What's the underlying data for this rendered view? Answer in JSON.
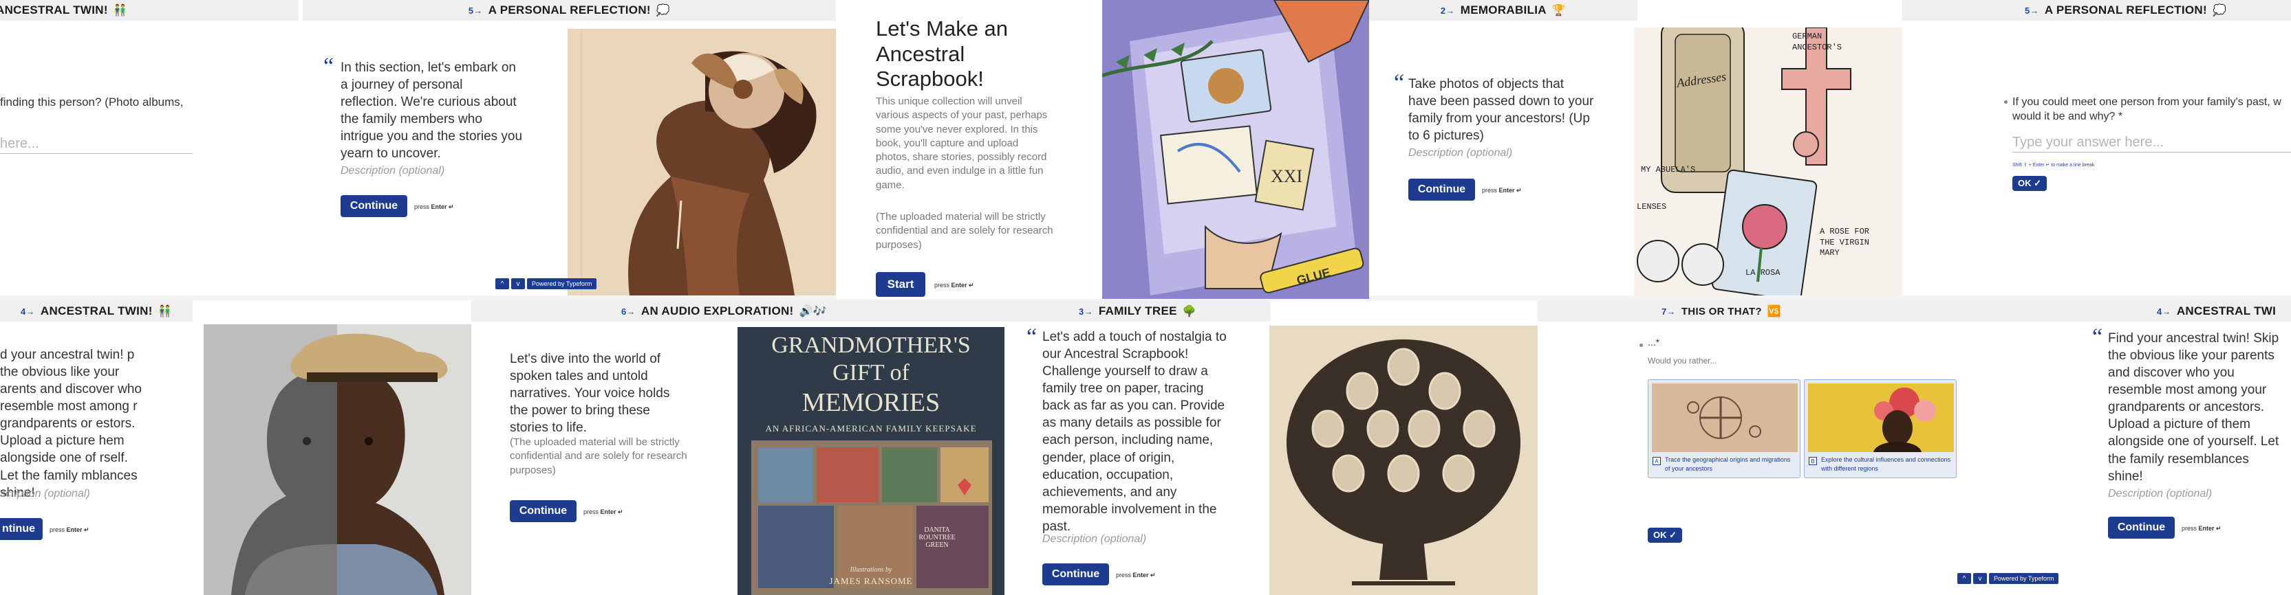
{
  "brand": {
    "accent": "#1d3c8f"
  },
  "top": {
    "p1": {
      "header": "ANCESTRAL TWIN!",
      "emoji": "👬",
      "body": "finding this person? (Photo albums,",
      "placeholder": "here..."
    },
    "p2": {
      "num": "5→",
      "header": "A PERSONAL REFLECTION!",
      "emoji": "💭",
      "body": "In this section, let's embark on a journey of personal reflection. We're curious about the family members who intrigue you and the stories you yearn to uncover.",
      "desc": "Description (optional)",
      "btn": "Continue",
      "press": "press",
      "enter": "Enter ↵",
      "nav_up": "^",
      "nav_down": "v",
      "powered": "Powered by Typeform"
    },
    "p3": {
      "title": "Let's Make an Ancestral Scrapbook!",
      "body": "This unique collection will unveil various aspects of your past, perhaps some you've never explored. In this book, you'll capture and upload photos, share stories, possibly record audio, and even indulge in a little fun game.",
      "note": "(The uploaded material will be strictly confidential and are solely for research purposes)",
      "btn": "Start",
      "press": "press",
      "enter": "Enter ↵"
    },
    "p4": {
      "num": "2→",
      "header": "MEMORABILIA",
      "emoji": "🏆",
      "body": "Take photos of objects that have been passed down to your family from your ancestors! (Up to 6 pictures)",
      "desc": "Description (optional)",
      "btn": "Continue",
      "press": "press",
      "enter": "Enter ↵",
      "sketch_labels": [
        "GERMAN ANCESTOR'S",
        "MY ABUELA'S",
        "LENSES",
        "A ROSE FOR THE VIRGIN MARY",
        "LA ROSA",
        "Addresses"
      ]
    },
    "p5": {
      "num": "5→",
      "header": "A PERSONAL REFLECTION!",
      "emoji": "💭",
      "question": "If you could meet one person from your family's past, w would it be and why? *",
      "placeholder": "Type your answer here...",
      "hint": "Shift ⇧ + Enter ↵ to make a line break",
      "btn": "OK ✓"
    }
  },
  "bottom": {
    "p1": {
      "num": "4→",
      "header": "ANCESTRAL TWIN!",
      "emoji": "👬",
      "body": "d your ancestral twin! p the obvious like your arents and discover who resemble most among r grandparents or estors. Upload a picture hem alongside one of rself. Let the family mblances shine!",
      "desc": "scription (optional)",
      "btn": "ntinue",
      "press": "press",
      "enter": "Enter ↵"
    },
    "p2": {
      "num": "6→",
      "header": "AN AUDIO EXPLORATION!",
      "emoji": "🔊🎶",
      "body": "Let's dive into the world of spoken tales and untold narratives. Your voice holds the power to bring these stories to life.",
      "note": "(The uploaded material will be strictly confidential and are solely for research purposes)",
      "btn": "Continue",
      "press": "press",
      "enter": "Enter ↵",
      "book_title_1": "GRANDMOTHER'S",
      "book_title_2": "GIFT of",
      "book_title_3": "MEMORIES",
      "book_sub": "AN AFRICAN-AMERICAN FAMILY KEEPSAKE",
      "book_author": "DANITA ROUNTREE GREEN",
      "book_illus": "Illustrations by",
      "book_illus2": "JAMES RANSOME"
    },
    "p3": {
      "num": "3→",
      "header": "FAMILY TREE",
      "emoji": "🌳",
      "body": "Let's add a touch of nostalgia to our Ancestral Scrapbook! Challenge yourself to draw a family tree on paper, tracing back as far as you can. Provide as many details as possible for each person, including name, gender, place of origin, education, occupation, achievements, and any memorable involvement in the past.",
      "desc": "Description (optional)",
      "btn": "Continue",
      "press": "press",
      "enter": "Enter ↵"
    },
    "p4": {
      "num": "7→",
      "header": "THIS OR THAT?",
      "emoji": "🆚",
      "question": "...*",
      "sub": "Would you rather...",
      "opt_a_key": "A",
      "opt_a": "Trace the geographical origins and migrations of your ancestors",
      "opt_b_key": "B",
      "opt_b": "Explore the cultural influences and connections with different regions",
      "btn": "OK ✓",
      "nav_up": "^",
      "nav_down": "v",
      "powered": "Powered by Typeform"
    },
    "p5": {
      "num": "4→",
      "header": "ANCESTRAL TWI",
      "body": "Find your ancestral twin! Skip the obvious like your parents and discover who you resemble most among your grandparents or ancestors. Upload a picture of them alongside one of yourself. Let the family resemblances shine!",
      "desc": "Description (optional)",
      "btn": "Continue",
      "press": "press",
      "enter": "Enter ↵"
    }
  }
}
